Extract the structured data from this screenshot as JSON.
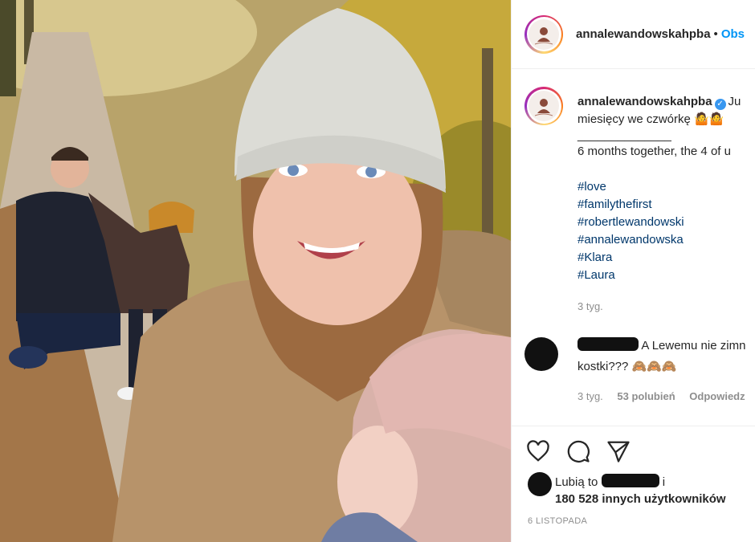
{
  "post": {
    "photo_alt": "Selfie of a family on an autumn forest path",
    "header": {
      "username": "annalewandowskahpba",
      "separator": "•",
      "follow_label": "Obs"
    },
    "caption": {
      "username": "annalewandowskahpba",
      "line1": "Ju",
      "line2": "miesięcy we czwórkę 🤷🤷",
      "divider": "______________",
      "line3": "6 months together, the 4 of u",
      "hashtags": [
        "#love",
        "#familythefirst",
        "#robertlewandowski",
        "#annalewandowska",
        "#Klara",
        "#Laura"
      ],
      "time": "3 tyg."
    },
    "comment": {
      "text1": "A Lewemu nie zimn",
      "text2": "kostki??? 🙈🙈🙈",
      "time": "3 tyg.",
      "likes": "53 polubień",
      "reply": "Odpowiedz"
    },
    "likes": {
      "prefix": "Lubią to",
      "suffix": "i",
      "others": "180 528 innych użytkowników"
    },
    "date": "6 LISTOPADA"
  },
  "colors": {
    "link": "#0095f6",
    "hashtag": "#00376b",
    "muted": "#8e8e8e",
    "verified": "#3897f0"
  }
}
